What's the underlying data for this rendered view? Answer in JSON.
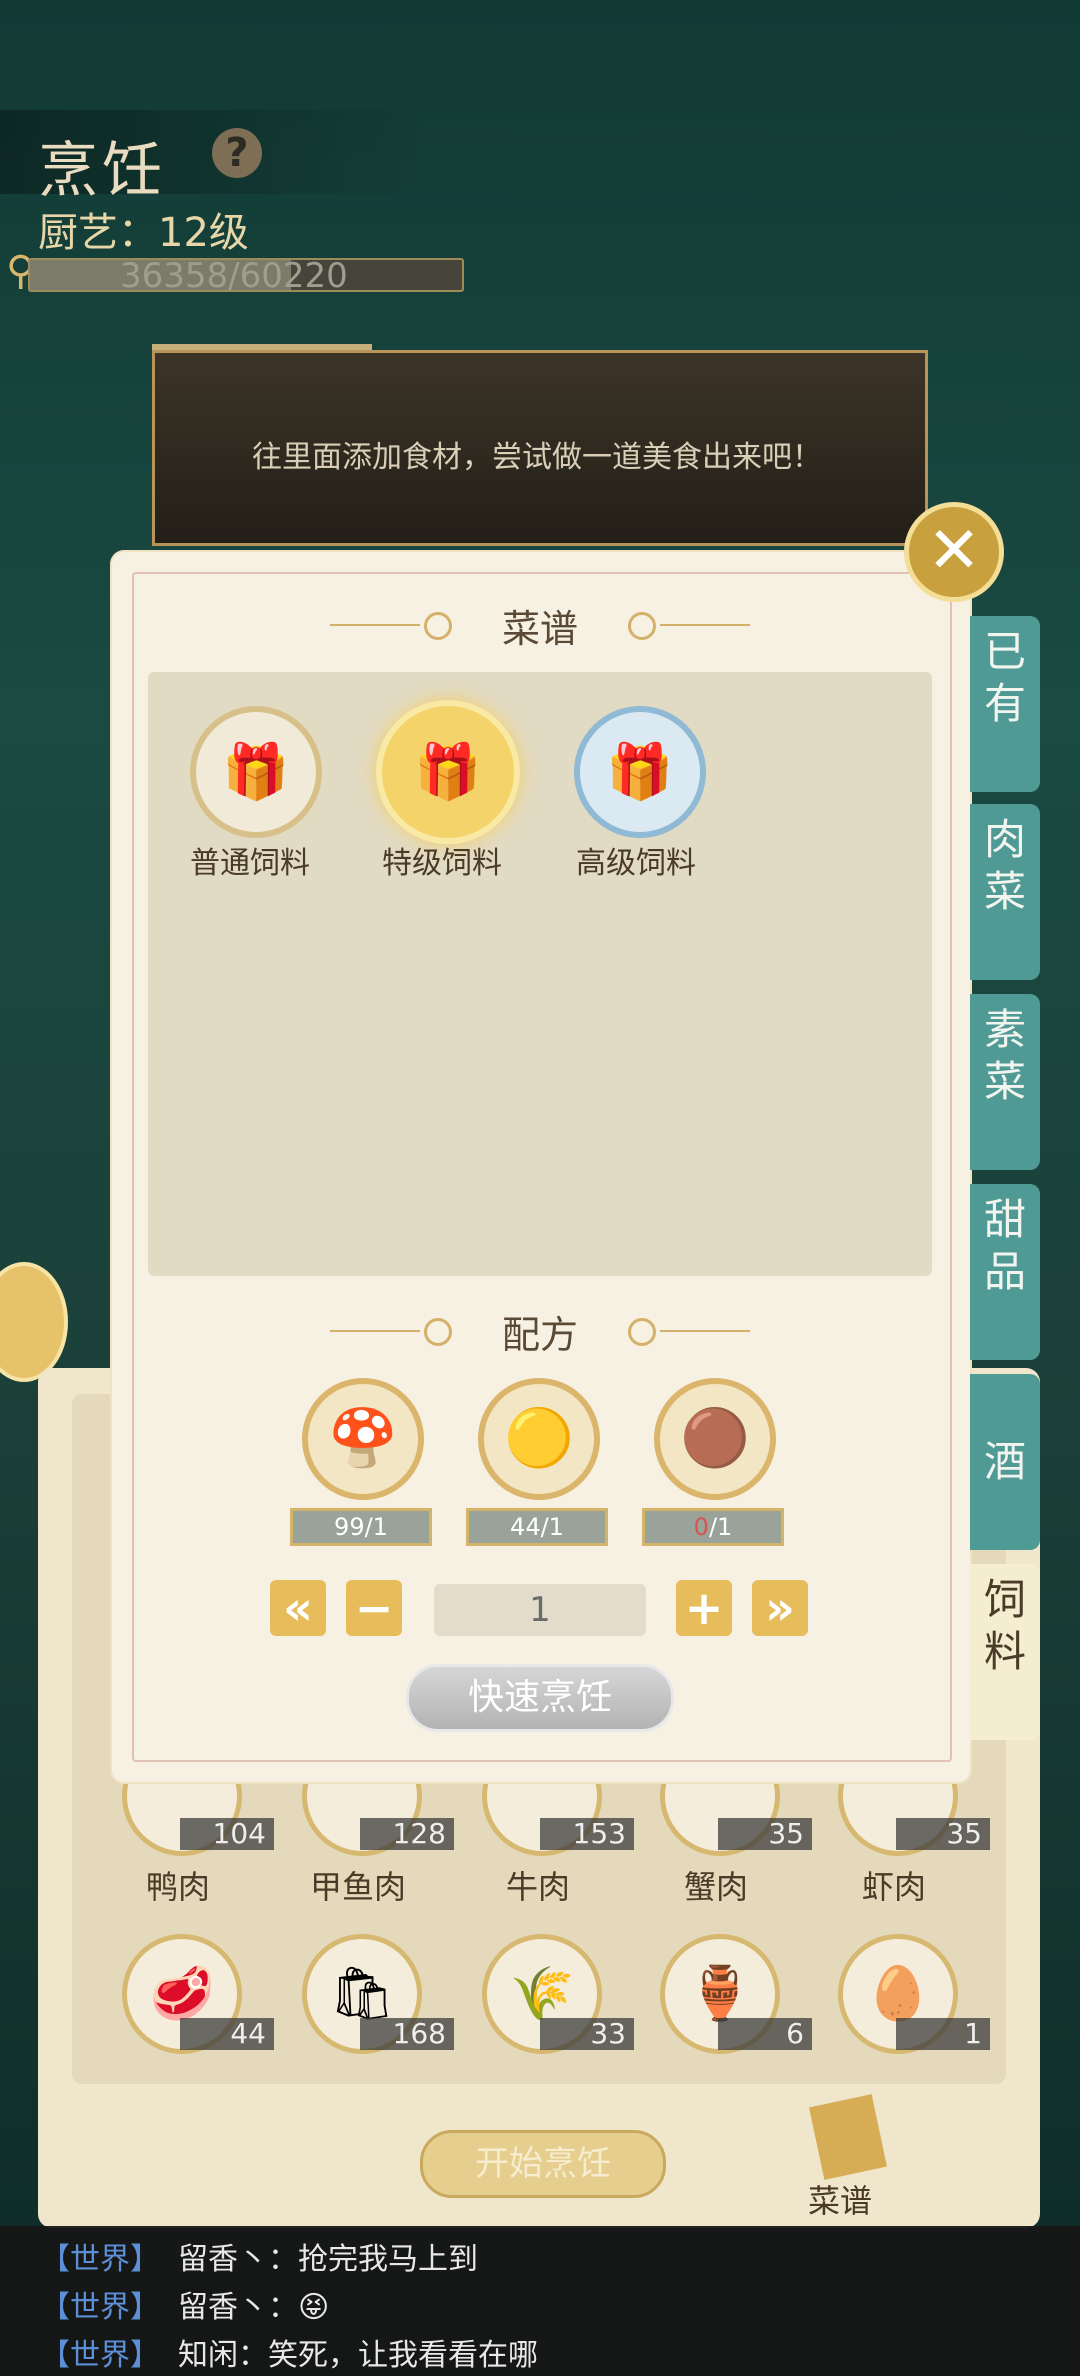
{
  "header": {
    "title": "烹饪",
    "skill": "厨艺：12级",
    "xp_text": "36358/60220",
    "xp_fraction": 0.604
  },
  "hint": {
    "text": "往里面添加食材，尝试做一道美食出来吧！"
  },
  "modal": {
    "recipe_title": "菜谱",
    "recipes": [
      {
        "label": "普通饲料",
        "icon": "feed-bag-icon"
      },
      {
        "label": "特级饲料",
        "icon": "feed-bag-icon"
      },
      {
        "label": "高级饲料",
        "icon": "feed-bag-icon"
      }
    ],
    "formula_title": "配方",
    "ingredients": [
      {
        "icon": "mushroom-icon",
        "have": "99",
        "need": "/1"
      },
      {
        "icon": "durian-icon",
        "have": "44",
        "need": "/1"
      },
      {
        "icon": "taro-icon",
        "have": "0",
        "need": "/1"
      }
    ],
    "quantity": "1",
    "quick_cook": "快速烹饪"
  },
  "tabs": [
    {
      "label": "已有",
      "active": false
    },
    {
      "label": "肉菜",
      "active": false
    },
    {
      "label": "素菜",
      "active": false
    },
    {
      "label": "甜品",
      "active": false
    },
    {
      "label": "酒",
      "active": false
    },
    {
      "label": "饲料",
      "active": true
    }
  ],
  "inventory": {
    "row1": [
      {
        "name": "鸭肉",
        "count": "104"
      },
      {
        "name": "甲鱼肉",
        "count": "128"
      },
      {
        "name": "牛肉",
        "count": "153"
      },
      {
        "name": "蟹肉",
        "count": "35"
      },
      {
        "name": "虾肉",
        "count": "35"
      }
    ],
    "row2": [
      {
        "icon": "meat-icon",
        "count": "44"
      },
      {
        "icon": "flour-bag-icon",
        "count": "168"
      },
      {
        "icon": "rice-plant-icon",
        "count": "33"
      },
      {
        "icon": "wine-jar-icon",
        "count": "6"
      },
      {
        "icon": "egg-icon",
        "count": "1"
      }
    ]
  },
  "start_cook": "开始烹饪",
  "recipe_book": "菜谱",
  "chat": [
    {
      "channel": "【世界】",
      "text": "留香丶：抢完我马上到"
    },
    {
      "channel": "【世界】",
      "text": "留香丶：😝"
    },
    {
      "channel": "【世界】",
      "text": "知闲：笑死，让我看看在哪"
    }
  ]
}
